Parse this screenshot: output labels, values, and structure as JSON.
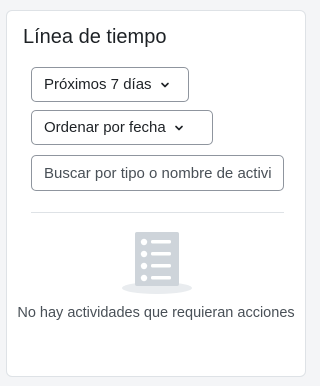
{
  "timeline": {
    "title": "Línea de tiempo",
    "filter_label": "Próximos 7 días",
    "sort_label": "Ordenar por fecha",
    "search_placeholder": "Buscar por tipo o nombre de actividad",
    "empty_message": "No hay actividades que requieran acciones"
  },
  "icons": {
    "filter_chevron": "chevron-down-icon",
    "sort_chevron": "chevron-down-icon",
    "empty_state": "checklist-icon"
  },
  "colors": {
    "border": "#8f959e",
    "text": "#1d2125",
    "muted_text": "#495057",
    "icon_fill": "#ced4da"
  }
}
